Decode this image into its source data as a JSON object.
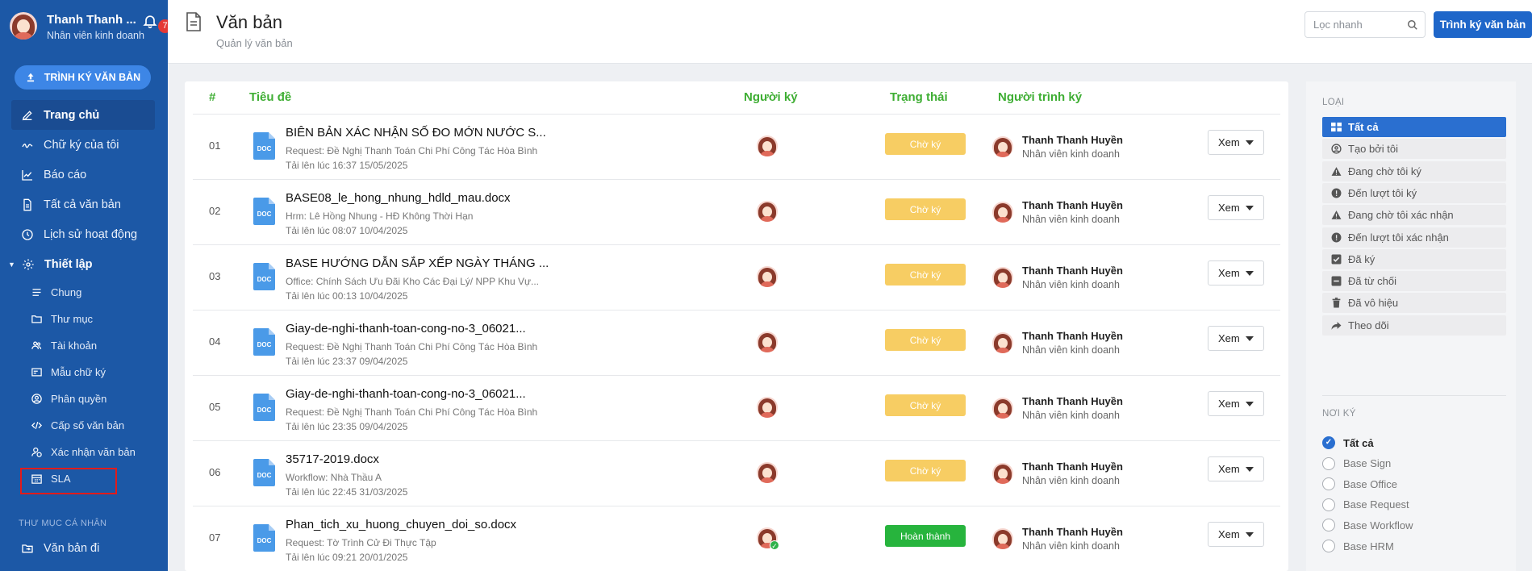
{
  "user": {
    "name": "Thanh Thanh ...",
    "role": "Nhân viên kinh doanh",
    "notifications": "7"
  },
  "sidebar": {
    "sign_button": "TRÌNH KÝ VĂN BẢN",
    "items": [
      {
        "label": "Trang chủ",
        "icon": "pen-icon"
      },
      {
        "label": "Chữ ký của tôi",
        "icon": "signature-icon"
      },
      {
        "label": "Báo cáo",
        "icon": "chart-icon"
      },
      {
        "label": "Tất cả văn bản",
        "icon": "document-icon"
      },
      {
        "label": "Lịch sử hoạt động",
        "icon": "clock-icon"
      }
    ],
    "settings_label": "Thiết lập",
    "sub_items": [
      {
        "label": "Chung",
        "icon": "list-icon"
      },
      {
        "label": "Thư mục",
        "icon": "folder-icon"
      },
      {
        "label": "Tài khoản",
        "icon": "users-icon"
      },
      {
        "label": "Mẫu chữ ký",
        "icon": "template-icon"
      },
      {
        "label": "Phân quyền",
        "icon": "user-circle-icon"
      },
      {
        "label": "Cấp số văn bản",
        "icon": "code-icon"
      },
      {
        "label": "Xác nhận văn bản",
        "icon": "user-check-icon"
      },
      {
        "label": "SLA",
        "icon": "calendar-icon"
      }
    ],
    "personal_section": "THƯ MỤC CÁ NHÂN",
    "personal_items": [
      {
        "label": "Văn bản đi",
        "icon": "send-folder-icon"
      }
    ]
  },
  "header": {
    "title": "Văn bản",
    "subtitle": "Quản lý văn bản",
    "search_placeholder": "Lọc nhanh",
    "sign_button": "Trình ký văn bản"
  },
  "table": {
    "columns": {
      "num": "#",
      "title": "Tiêu đề",
      "signer": "Người ký",
      "status": "Trạng thái",
      "sender": "Người trình ký"
    },
    "view_label": "Xem",
    "rows": [
      {
        "num": "01",
        "type": "DOC",
        "title": "BIÊN BẢN XÁC NHẬN SỐ ĐO MỚN NƯỚC S...",
        "meta": "Request: Đề Nghị Thanh Toán Chi Phí Công Tác Hòa Bình",
        "time": "Tải lên lúc 16:37 15/05/2025",
        "status": "Chờ ký",
        "status_kind": "pending",
        "signed": false,
        "sender_name": "Thanh Thanh Huyền",
        "sender_role": "Nhân viên kinh doanh"
      },
      {
        "num": "02",
        "type": "DOC",
        "title": "BASE08_le_hong_nhung_hdld_mau.docx",
        "meta": "Hrm: Lê Hồng Nhung - HĐ Không Thời Hạn",
        "time": "Tải lên lúc 08:07 10/04/2025",
        "status": "Chờ ký",
        "status_kind": "pending",
        "signed": false,
        "sender_name": "Thanh Thanh Huyền",
        "sender_role": "Nhân viên kinh doanh"
      },
      {
        "num": "03",
        "type": "DOC",
        "title": "BASE HƯỚNG DẪN SẮP XẾP NGÀY THÁNG ...",
        "meta": "Office: Chính Sách Ưu Đãi Kho Các Đại Lý/ NPP Khu Vự...",
        "time": "Tải lên lúc 00:13 10/04/2025",
        "status": "Chờ ký",
        "status_kind": "pending",
        "signed": false,
        "sender_name": "Thanh Thanh Huyền",
        "sender_role": "Nhân viên kinh doanh"
      },
      {
        "num": "04",
        "type": "DOC",
        "title": "Giay-de-nghi-thanh-toan-cong-no-3_06021...",
        "meta": "Request: Đề Nghị Thanh Toán Chi Phí Công Tác Hòa Bình",
        "time": "Tải lên lúc 23:37 09/04/2025",
        "status": "Chờ ký",
        "status_kind": "pending",
        "signed": false,
        "sender_name": "Thanh Thanh Huyền",
        "sender_role": "Nhân viên kinh doanh"
      },
      {
        "num": "05",
        "type": "DOC",
        "title": "Giay-de-nghi-thanh-toan-cong-no-3_06021...",
        "meta": "Request: Đề Nghị Thanh Toán Chi Phí Công Tác Hòa Bình",
        "time": "Tải lên lúc 23:35 09/04/2025",
        "status": "Chờ ký",
        "status_kind": "pending",
        "signed": false,
        "sender_name": "Thanh Thanh Huyền",
        "sender_role": "Nhân viên kinh doanh"
      },
      {
        "num": "06",
        "type": "DOC",
        "title": "35717-2019.docx",
        "meta": "Workflow: Nhà Thầu A",
        "time": "Tải lên lúc 22:45 31/03/2025",
        "status": "Chờ ký",
        "status_kind": "pending",
        "signed": false,
        "sender_name": "Thanh Thanh Huyền",
        "sender_role": "Nhân viên kinh doanh"
      },
      {
        "num": "07",
        "type": "DOC",
        "title": "Phan_tich_xu_huong_chuyen_doi_so.docx",
        "meta": "Request: Tờ Trình Cử Đi Thực Tập",
        "time": "Tải lên lúc 09:21 20/01/2025",
        "status": "Hoàn thành",
        "status_kind": "done",
        "signed": true,
        "sender_name": "Thanh Thanh Huyền",
        "sender_role": "Nhân viên kinh doanh"
      }
    ]
  },
  "filter": {
    "type_title": "LOẠI",
    "types": [
      {
        "label": "Tất cả",
        "icon": "grid-icon",
        "active": true
      },
      {
        "label": "Tạo bởi tôi",
        "icon": "user-circle-icon"
      },
      {
        "label": "Đang chờ tôi ký",
        "icon": "warning-icon"
      },
      {
        "label": "Đến lượt tôi ký",
        "icon": "alert-circle-icon"
      },
      {
        "label": "Đang chờ tôi xác nhận",
        "icon": "warning-icon"
      },
      {
        "label": "Đến lượt tôi xác nhận",
        "icon": "alert-circle-icon"
      },
      {
        "label": "Đã ký",
        "icon": "checkbox-icon"
      },
      {
        "label": "Đã từ chối",
        "icon": "minus-square-icon"
      },
      {
        "label": "Đã vô hiệu",
        "icon": "trash-icon"
      },
      {
        "label": "Theo dõi",
        "icon": "share-icon"
      }
    ],
    "place_title": "NƠI KÝ",
    "places": [
      {
        "label": "Tất cả",
        "checked": true
      },
      {
        "label": "Base Sign"
      },
      {
        "label": "Base Office"
      },
      {
        "label": "Base Request"
      },
      {
        "label": "Base Workflow"
      },
      {
        "label": "Base HRM"
      }
    ]
  },
  "colors": {
    "sidebar": "#1c58a6",
    "accent": "#1e66c9",
    "header_text": "#3fae34",
    "pending": "#f7cd63",
    "done": "#27b43d"
  }
}
